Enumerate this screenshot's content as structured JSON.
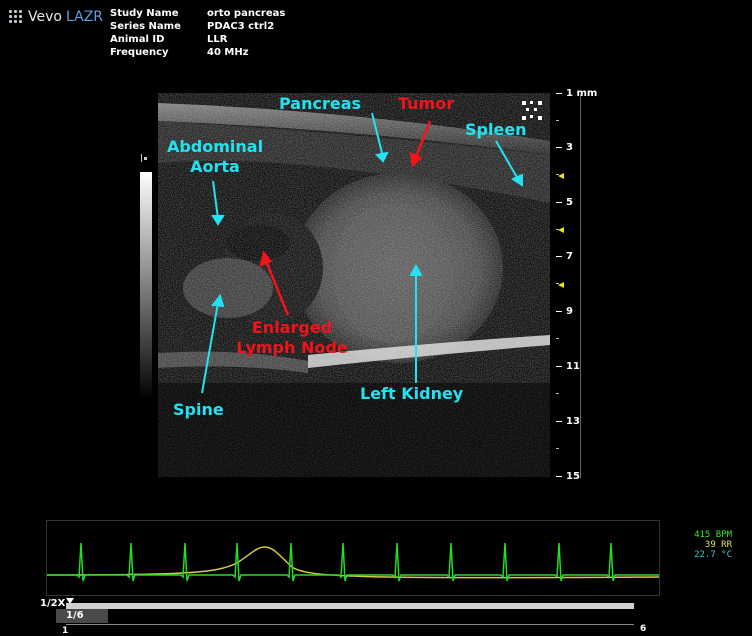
{
  "header": {
    "logo_primary": "Vevo",
    "logo_secondary": "LAZR",
    "metadata": [
      {
        "key": "Study Name",
        "value": "orto pancreas"
      },
      {
        "key": "Series Name",
        "value": "PDAC3 ctrl2"
      },
      {
        "key": "Animal ID",
        "value": "LLR"
      },
      {
        "key": "Frequency",
        "value": "40 MHz"
      }
    ]
  },
  "annotations": {
    "pancreas": "Pancreas",
    "tumor": "Tumor",
    "spleen": "Spleen",
    "abdominal_aorta_line1": "Abdominal",
    "abdominal_aorta_line2": "Aorta",
    "enlarged_lymph_line1": "Enlarged",
    "enlarged_lymph_line2": "Lymph Node",
    "left_kidney": "Left Kidney",
    "spine": "Spine",
    "colors": {
      "cyan": "#21e3f2",
      "red": "#f0141b"
    }
  },
  "depth_scale": {
    "top_label": "1 mm",
    "labels": [
      "3",
      "5",
      "7",
      "9",
      "11",
      "13",
      "15"
    ],
    "focus_marker_color": "#e8e800"
  },
  "vitals": {
    "heart_rate": "415 BPM",
    "resp_rate": "39 RR",
    "temperature": "22.7 °C",
    "colors": {
      "heart_rate": "#33e633",
      "resp_rate": "#e6e633",
      "temperature": "#33cccc"
    }
  },
  "cine": {
    "speed": "1/2X",
    "frame": "1/6",
    "start": "1",
    "end": "6"
  },
  "icons": {
    "logo": "dot-grid-icon",
    "image_corner": "dot-pattern-icon"
  }
}
